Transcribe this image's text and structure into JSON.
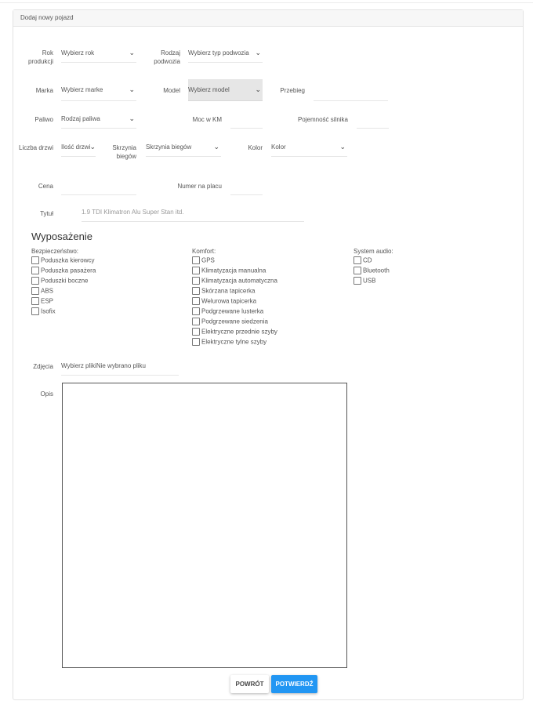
{
  "panel": {
    "title": "Dodaj nowy pojazd"
  },
  "form": {
    "year": {
      "label": "Rok produkcji",
      "value": "Wybierz rok"
    },
    "body": {
      "label": "Rodzaj podwozia",
      "value": "Wybierz typ podwozia"
    },
    "brand": {
      "label": "Marka",
      "value": "Wybierz marke"
    },
    "model": {
      "label": "Model",
      "value": "Wybierz model"
    },
    "mileage": {
      "label": "Przebieg",
      "value": ""
    },
    "fuel": {
      "label": "Paliwo",
      "value": "Rodzaj paliwa"
    },
    "power": {
      "label": "Moc w KM",
      "value": ""
    },
    "engine": {
      "label": "Pojemność silnika",
      "value": ""
    },
    "doors": {
      "label": "Liczba drzwi",
      "value": "Ilość drzwi"
    },
    "gearbox": {
      "label": "Skrzynia biegów",
      "value": "Skrzynia biegów"
    },
    "color": {
      "label": "Kolor",
      "value": "Kolor"
    },
    "price": {
      "label": "Cena",
      "value": ""
    },
    "lot": {
      "label": "Numer na placu",
      "value": ""
    },
    "title": {
      "label": "Tytuł",
      "placeholder": "1.9 TDI Klimatron Alu Super Stan itd."
    }
  },
  "equipment": {
    "heading": "Wyposażenie",
    "safety": {
      "title": "Bezpieczeństwo:",
      "items": [
        "Poduszka kierowcy",
        "Poduszka pasażera",
        "Poduszki boczne",
        "ABS",
        "ESP",
        "Isofix"
      ]
    },
    "comfort": {
      "title": "Komfort:",
      "items": [
        "GPS",
        "Klimatyzacja manualna",
        "Klimatyzacja automatyczna",
        "Skórzana tapicerka",
        "Welurowa tapicerka",
        "Podgrzewane lusterka",
        "Podgrzewane siedzenia",
        "Elektryczne przednie szyby",
        "Elektryczne tylne szyby"
      ]
    },
    "audio": {
      "title": "System audio:",
      "items": [
        "CD",
        "Bluetooth",
        "USB"
      ]
    }
  },
  "photos": {
    "label": "Zdjęcia",
    "value": "Wybierz plikiNie wybrano pliku"
  },
  "description": {
    "label": "Opis",
    "value": ""
  },
  "buttons": {
    "back": "POWRÓT",
    "confirm": "POTWIERDŹ"
  },
  "colors": {
    "primary": "#2196f3"
  }
}
